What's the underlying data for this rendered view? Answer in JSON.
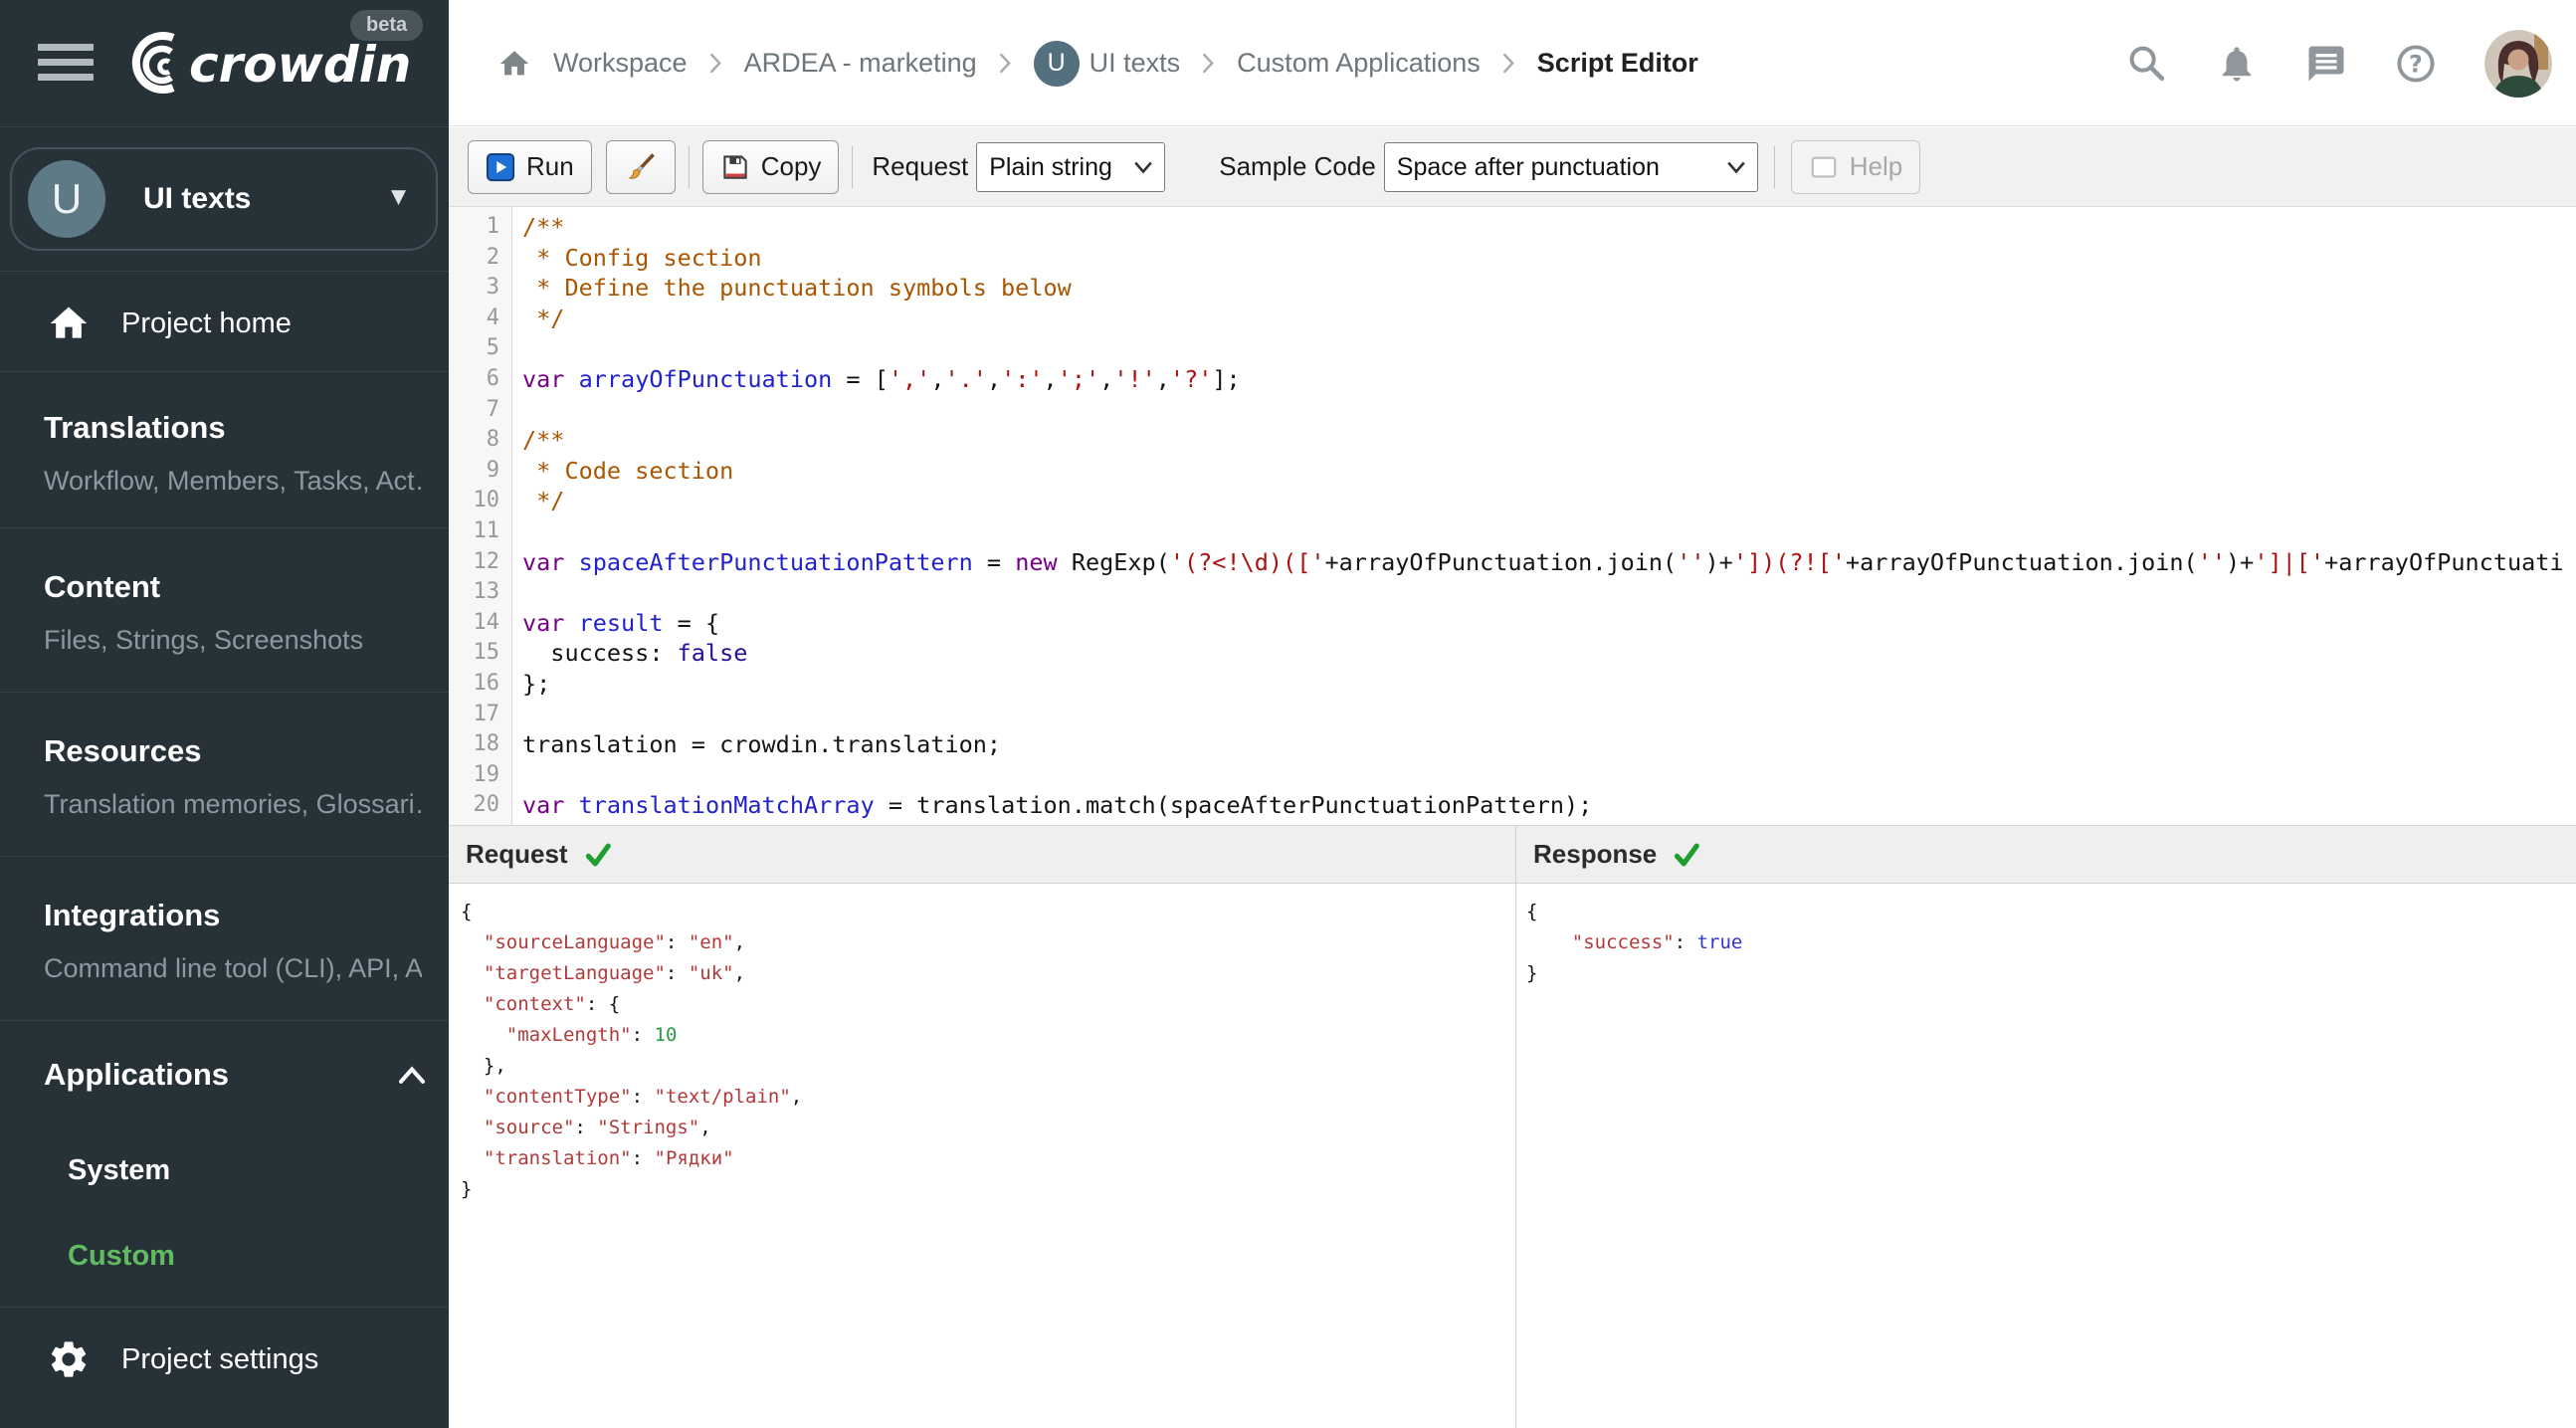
{
  "sidebar": {
    "brand": "crowdin",
    "beta_label": "beta",
    "project_selector": {
      "initial": "U",
      "name": "UI texts"
    },
    "home_item": "Project home",
    "sections": [
      {
        "title": "Translations",
        "subtitle": "Workflow, Members, Tasks, Act…"
      },
      {
        "title": "Content",
        "subtitle": "Files, Strings, Screenshots"
      },
      {
        "title": "Resources",
        "subtitle": "Translation memories, Glossari…"
      },
      {
        "title": "Integrations",
        "subtitle": "Command line tool (CLI), API, A…"
      }
    ],
    "applications": {
      "title": "Applications",
      "items": [
        {
          "label": "System",
          "active": false
        },
        {
          "label": "Custom",
          "active": true
        }
      ]
    },
    "settings_label": "Project settings"
  },
  "breadcrumb": {
    "project_initial": "U",
    "items": [
      "Workspace",
      "ARDEA - marketing",
      "UI texts",
      "Custom Applications",
      "Script Editor"
    ]
  },
  "toolbar": {
    "run_label": "Run",
    "copy_label": "Copy",
    "request_label": "Request",
    "request_value": "Plain string",
    "sample_label": "Sample Code",
    "sample_value": "Space after punctuation",
    "help_label": "Help"
  },
  "editor": {
    "lines": [
      [
        [
          "com",
          "/**"
        ]
      ],
      [
        [
          "com",
          " * Config section"
        ]
      ],
      [
        [
          "com",
          " * Define the punctuation symbols below"
        ]
      ],
      [
        [
          "com",
          " */"
        ]
      ],
      [],
      [
        [
          "kw",
          "var"
        ],
        [
          "pl",
          " "
        ],
        [
          "def",
          "arrayOfPunctuation"
        ],
        [
          "pl",
          " = ["
        ],
        [
          "str",
          "','"
        ],
        [
          "pl",
          ","
        ],
        [
          "str",
          "'.'"
        ],
        [
          "pl",
          ","
        ],
        [
          "str",
          "':'"
        ],
        [
          "pl",
          ","
        ],
        [
          "str",
          "';'"
        ],
        [
          "pl",
          ","
        ],
        [
          "str",
          "'!'"
        ],
        [
          "pl",
          ","
        ],
        [
          "str",
          "'?'"
        ],
        [
          "pl",
          "];"
        ]
      ],
      [],
      [
        [
          "com",
          "/**"
        ]
      ],
      [
        [
          "com",
          " * Code section"
        ]
      ],
      [
        [
          "com",
          " */"
        ]
      ],
      [],
      [
        [
          "kw",
          "var"
        ],
        [
          "pl",
          " "
        ],
        [
          "def",
          "spaceAfterPunctuationPattern"
        ],
        [
          "pl",
          " = "
        ],
        [
          "kw",
          "new"
        ],
        [
          "pl",
          " RegExp("
        ],
        [
          "str",
          "'(?<!\\d)(['"
        ],
        [
          "pl",
          "+arrayOfPunctuation.join("
        ],
        [
          "str",
          "''"
        ],
        [
          "pl",
          ")+"
        ],
        [
          "str",
          "'])(?!['"
        ],
        [
          "pl",
          "+arrayOfPunctuation.join("
        ],
        [
          "str",
          "''"
        ],
        [
          "pl",
          ")+"
        ],
        [
          "str",
          "']|['"
        ],
        [
          "pl",
          "+arrayOfPunctuati"
        ]
      ],
      [],
      [
        [
          "kw",
          "var"
        ],
        [
          "pl",
          " "
        ],
        [
          "def",
          "result"
        ],
        [
          "pl",
          " = {"
        ]
      ],
      [
        [
          "pl",
          "  success: "
        ],
        [
          "atom",
          "false"
        ]
      ],
      [
        [
          "pl",
          "};"
        ]
      ],
      [],
      [
        [
          "pl",
          "translation = crowdin.translation;"
        ]
      ],
      [],
      [
        [
          "kw",
          "var"
        ],
        [
          "pl",
          " "
        ],
        [
          "def",
          "translationMatchArray"
        ],
        [
          "pl",
          " = translation.match(spaceAfterPunctuationPattern);"
        ]
      ]
    ]
  },
  "panels": {
    "request": {
      "title": "Request",
      "status_icon": "green-check",
      "lines": [
        [
          [
            "pl",
            "{"
          ]
        ],
        [
          [
            "pl",
            "  "
          ],
          [
            "key",
            "\"sourceLanguage\""
          ],
          [
            "pl",
            ": "
          ],
          [
            "jstr",
            "\"en\""
          ],
          [
            "pl",
            ","
          ]
        ],
        [
          [
            "pl",
            "  "
          ],
          [
            "key",
            "\"targetLanguage\""
          ],
          [
            "pl",
            ": "
          ],
          [
            "jstr",
            "\"uk\""
          ],
          [
            "pl",
            ","
          ]
        ],
        [
          [
            "pl",
            "  "
          ],
          [
            "key",
            "\"context\""
          ],
          [
            "pl",
            ": {"
          ]
        ],
        [
          [
            "pl",
            "    "
          ],
          [
            "key",
            "\"maxLength\""
          ],
          [
            "pl",
            ": "
          ],
          [
            "num",
            "10"
          ]
        ],
        [
          [
            "pl",
            "  },"
          ]
        ],
        [
          [
            "pl",
            "  "
          ],
          [
            "key",
            "\"contentType\""
          ],
          [
            "pl",
            ": "
          ],
          [
            "jstr",
            "\"text/plain\""
          ],
          [
            "pl",
            ","
          ]
        ],
        [
          [
            "pl",
            "  "
          ],
          [
            "key",
            "\"source\""
          ],
          [
            "pl",
            ": "
          ],
          [
            "jstr",
            "\"Strings\""
          ],
          [
            "pl",
            ","
          ]
        ],
        [
          [
            "pl",
            "  "
          ],
          [
            "key",
            "\"translation\""
          ],
          [
            "pl",
            ": "
          ],
          [
            "jstr",
            "\"Рядки\""
          ]
        ],
        [
          [
            "pl",
            "}"
          ]
        ]
      ]
    },
    "response": {
      "title": "Response",
      "status_icon": "green-check",
      "lines": [
        [
          [
            "pl",
            "{"
          ]
        ],
        [
          [
            "pl",
            "    "
          ],
          [
            "key",
            "\"success\""
          ],
          [
            "pl",
            ": "
          ],
          [
            "jatom",
            "true"
          ]
        ],
        [
          [
            "pl",
            "}"
          ]
        ]
      ]
    }
  },
  "colors": {
    "sidebar_bg": "#263238",
    "active_green": "#61bb61",
    "check_green": "#1f9d2f",
    "comment": "#aa5500",
    "keyword": "#770088",
    "definition": "#2222cc",
    "string": "#aa1111",
    "atom": "#221199",
    "json_key": "#b13a3a",
    "json_number": "#2a9946",
    "json_atom": "#3333cc",
    "run_icon_blue": "#1e6fd6"
  }
}
